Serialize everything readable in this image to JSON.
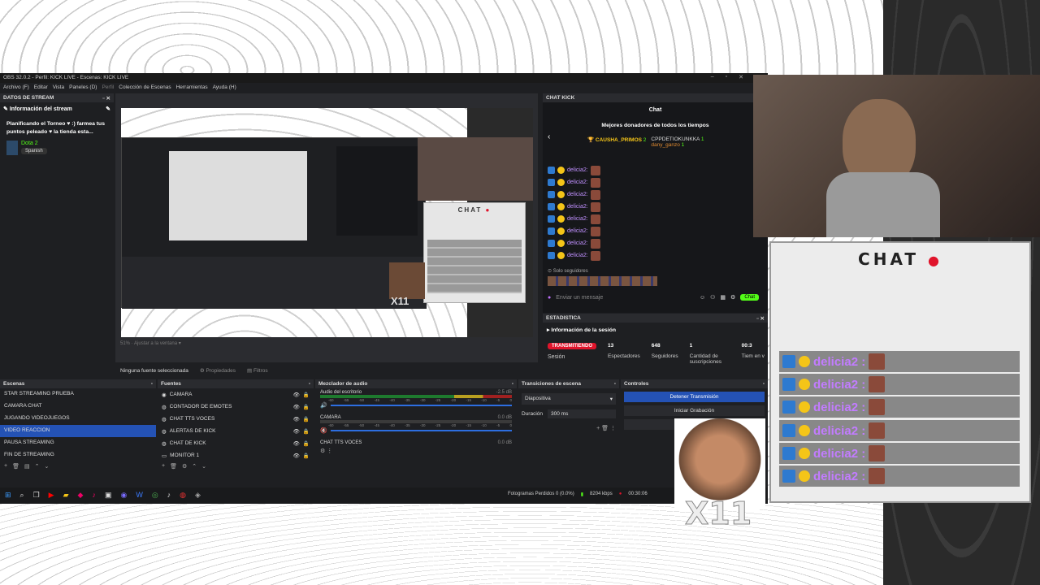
{
  "obs": {
    "title": "OBS 32.0.2 - Perfil: KICK LIVE - Escenas: KICK LIVE",
    "menu": [
      "Archivo (F)",
      "Editar",
      "Vista",
      "Paneles (D)",
      "Perfil",
      "Colección de Escenas",
      "Herramientas",
      "Ayuda (H)"
    ]
  },
  "stream_info": {
    "dock_title": "DATOS DE STREAM",
    "header": "Información del stream",
    "stream_title": "Planificando el Torneo ♥ :) farmea tus puntos peleado ♥ la tienda esta...",
    "category": "Dota 2",
    "language": "Spanish"
  },
  "preview": {
    "zoom": "51%",
    "fit": "Ajustar a la ventana",
    "no_source": "Ninguna fuente seleccionada",
    "properties": "Propiedades",
    "filters": "Filtros"
  },
  "chat_dock": {
    "dock_title": "CHAT KICK",
    "title": "Chat",
    "top_donors_title": "Mejores donadores de todos los tiempos",
    "donor1": "CAUSHA_PRIMOS",
    "donor1_count": "2",
    "donor2": "CPPDETIOKUNKKA",
    "donor2_count": "1",
    "donor3": "dany_ganzo",
    "donor3_count": "1",
    "messages": [
      "delicia2:",
      "delicia2:",
      "delicia2:",
      "delicia2:",
      "delicia2:",
      "delicia2:",
      "delicia2:",
      "delicia2:"
    ],
    "followers_only": "Solo seguidores",
    "input_placeholder": "Enviar un mensaje",
    "send": "Chat"
  },
  "stats": {
    "dock_title": "ESTADISTICA",
    "header": "Información de la sesión",
    "status": "TRANSMITIENDO",
    "session": "Sesión",
    "viewers_value": "13",
    "viewers_label": "Espectadores",
    "followers_value": "648",
    "followers_label": "Seguidores",
    "subs_value": "1",
    "subs_label": "Cantidad de suscripciones",
    "time_value": "00:3",
    "time_label": "Tiem en v"
  },
  "scenes": {
    "title": "Escenas",
    "items": [
      "STAR STREAMING PRUEBA",
      "CAMARA CHAT",
      "JUGANDO VIDEOJUEGOS",
      "VIDEO REACCION",
      "PAUSA STREAMING",
      "FIN DE STREAMING"
    ],
    "selected_index": 3
  },
  "sources": {
    "title": "Fuentes",
    "items": [
      "CAMARA",
      "CONTADOR DE EMOTES",
      "CHAT TTS VOCES",
      "ALERTAS DE KICK",
      "CHAT DE KICK",
      "MONITOR 1"
    ]
  },
  "mixer": {
    "title": "Mezclador de audio",
    "ch1": "Audio del escritorio",
    "ch1_db": "-2.5 dB",
    "ch2": "CAMARA",
    "ch2_db": "0.0 dB",
    "ch3": "CHAT TTS VOCES",
    "ch3_db": "0.0 dB",
    "ticks": [
      "-60",
      "-55",
      "-50",
      "-45",
      "-40",
      "-35",
      "-30",
      "-25",
      "-20",
      "-15",
      "-10",
      "-5",
      "0"
    ]
  },
  "transitions": {
    "title": "Transiciones de escena",
    "type": "Diapositiva",
    "duration_label": "Duración",
    "duration": "300 ms"
  },
  "controls": {
    "title": "Controles",
    "stop_stream": "Detener Transmisión",
    "start_rec": "Iniciar Grabación",
    "start_other": "Iniciar"
  },
  "statusbar": {
    "dropped": "Fotogramas Perdidos 0 (0.0%)",
    "bitrate": "8204 kbps",
    "time": "00:30:06"
  },
  "overlay_chat": {
    "title": "CHAT",
    "messages": [
      "delicia2 :",
      "delicia2 :",
      "delicia2 :",
      "delicia2 :",
      "delicia2 :",
      "delicia2 :"
    ],
    "emote_count": "X11"
  },
  "inner_preview": {
    "chat_title": "CHAT",
    "emote_count": "X11"
  },
  "colors": {
    "accent": "#53fc18",
    "selected": "#2452b5",
    "live": "#e0142b"
  }
}
